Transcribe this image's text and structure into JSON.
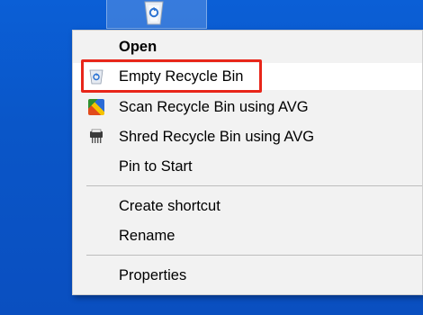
{
  "desktop": {
    "recycle_bin_icon": "recycle-bin-icon"
  },
  "context_menu": {
    "items": [
      {
        "label": "Open",
        "bold": true,
        "icon": null
      },
      {
        "label": "Empty Recycle Bin",
        "bold": false,
        "icon": "recycle-bin-icon",
        "highlighted": true
      },
      {
        "label": "Scan Recycle Bin using AVG",
        "bold": false,
        "icon": "avg-scan-icon"
      },
      {
        "label": "Shred Recycle Bin using AVG",
        "bold": false,
        "icon": "shredder-icon"
      },
      {
        "label": "Pin to Start",
        "bold": false,
        "icon": null
      },
      {
        "label": "Create shortcut",
        "bold": false,
        "icon": null
      },
      {
        "label": "Rename",
        "bold": false,
        "icon": null
      },
      {
        "label": "Properties",
        "bold": false,
        "icon": null
      }
    ]
  },
  "colors": {
    "desktop_bg": "#0b5fd6",
    "menu_bg": "#f2f2f2",
    "highlight_row": "#ffffff",
    "annotation_border": "#e8261a"
  }
}
